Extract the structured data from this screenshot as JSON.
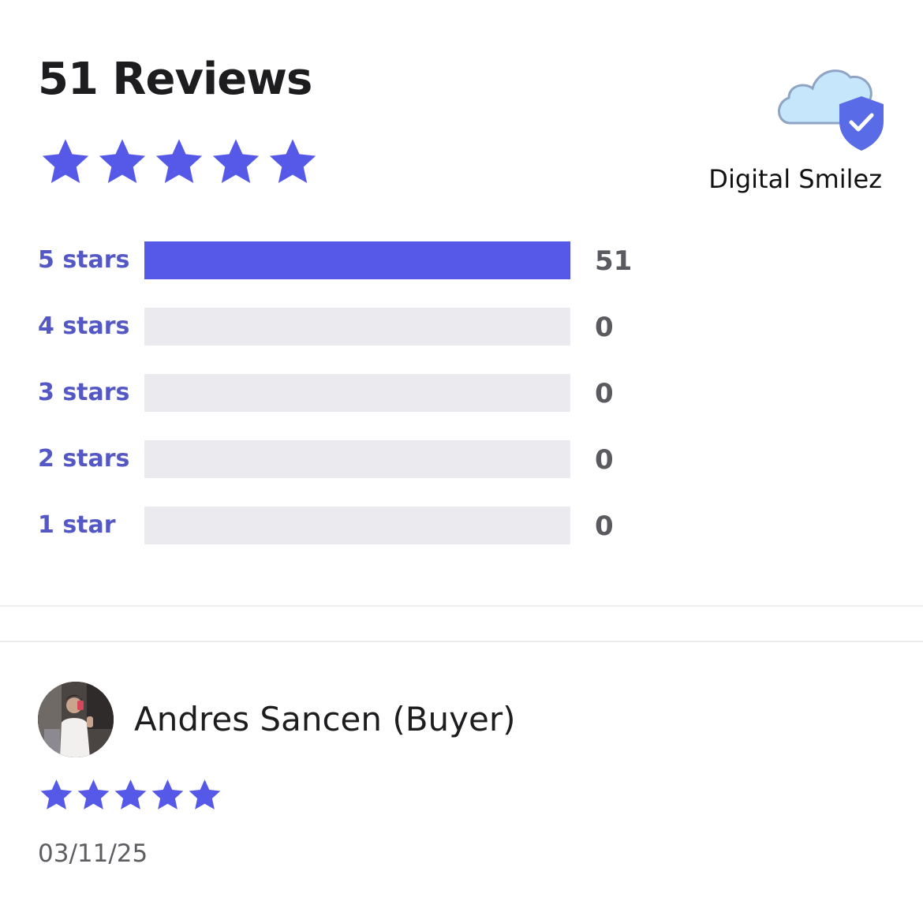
{
  "header": {
    "title": "51 Reviews",
    "average_rating_stars": 5,
    "max_stars": 5
  },
  "brand": {
    "name": "Digital Smilez",
    "logo_icon": "cloud-shield-check-icon"
  },
  "breakdown": {
    "rows": [
      {
        "label": "5 stars",
        "count": "51",
        "fraction": 1.0
      },
      {
        "label": "4 stars",
        "count": "0",
        "fraction": 0
      },
      {
        "label": "3 stars",
        "count": "0",
        "fraction": 0
      },
      {
        "label": "2 stars",
        "count": "0",
        "fraction": 0
      },
      {
        "label": "1 star",
        "count": "0",
        "fraction": 0
      }
    ]
  },
  "review": {
    "reviewer": "Andres Sancen (Buyer)",
    "rating_stars": 5,
    "date": "03/11/25"
  },
  "colors": {
    "accent": "#5659e8",
    "label_text": "#5458c4",
    "track": "#ebebef",
    "shield": "#5a6be8",
    "cloud": "#c5e6fb"
  }
}
